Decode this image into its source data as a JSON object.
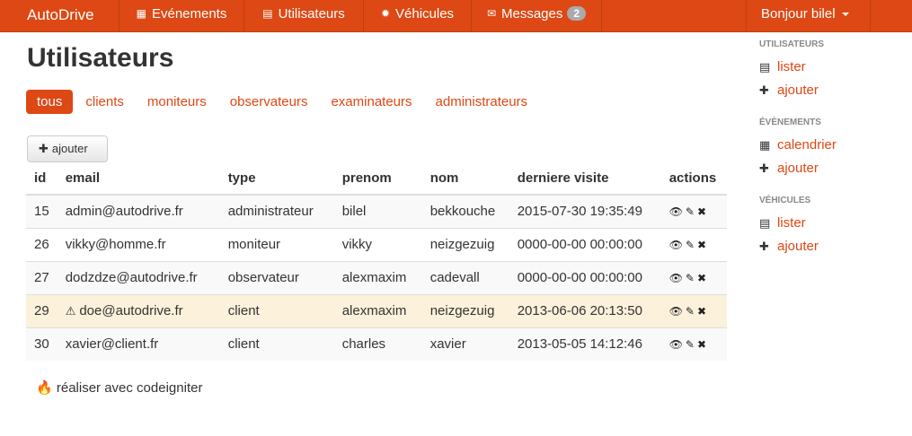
{
  "nav": {
    "brand": "AutoDrive",
    "items": [
      {
        "label": "Evénements",
        "icon": "calendar-icon"
      },
      {
        "label": "Utilisateurs",
        "icon": "list-icon"
      },
      {
        "label": "Véhicules",
        "icon": "cog-icon"
      },
      {
        "label": "Messages",
        "icon": "envelope-icon",
        "badge": "2"
      }
    ],
    "user": "Bonjour bilel"
  },
  "page_title": "Utilisateurs",
  "filters": [
    "tous",
    "clients",
    "moniteurs",
    "observateurs",
    "examinateurs",
    "administrateurs"
  ],
  "active_filter": "tous",
  "add_button": "ajouter",
  "table": {
    "headers": [
      "id",
      "email",
      "type",
      "prenom",
      "nom",
      "derniere visite",
      "actions"
    ],
    "rows": [
      {
        "id": "15",
        "email": "admin@autodrive.fr",
        "type": "administrateur",
        "prenom": "bilel",
        "nom": "bekkouche",
        "visit": "2015-07-30 19:35:49",
        "warning": false
      },
      {
        "id": "26",
        "email": "vikky@homme.fr",
        "type": "moniteur",
        "prenom": "vikky",
        "nom": "neizgezuig",
        "visit": "0000-00-00 00:00:00",
        "warning": false
      },
      {
        "id": "27",
        "email": "dodzdze@autodrive.fr",
        "type": "observateur",
        "prenom": "alexmaxim",
        "nom": "cadevall",
        "visit": "0000-00-00 00:00:00",
        "warning": false
      },
      {
        "id": "29",
        "email": "doe@autodrive.fr",
        "type": "client",
        "prenom": "alexmaxim",
        "nom": "neizgezuig",
        "visit": "2013-06-06 20:13:50",
        "warning": true
      },
      {
        "id": "30",
        "email": "xavier@client.fr",
        "type": "client",
        "prenom": "charles",
        "nom": "xavier",
        "visit": "2013-05-05 14:12:46",
        "warning": false
      }
    ]
  },
  "footer": "réaliser avec codeigniter",
  "sidebar": [
    {
      "heading": "UTILISATEURS",
      "links": [
        {
          "label": "lister",
          "icon": "list-icon"
        },
        {
          "label": "ajouter",
          "icon": "plus-icon"
        }
      ]
    },
    {
      "heading": "ÉVÈNEMENTS",
      "links": [
        {
          "label": "calendrier",
          "icon": "calendar-icon"
        },
        {
          "label": "ajouter",
          "icon": "plus-icon"
        }
      ]
    },
    {
      "heading": "VÉHICULES",
      "links": [
        {
          "label": "lister",
          "icon": "list-icon"
        },
        {
          "label": "ajouter",
          "icon": "plus-icon"
        }
      ]
    }
  ],
  "colors": {
    "accent": "#dd4814",
    "warning_row": "#fcf1da"
  }
}
